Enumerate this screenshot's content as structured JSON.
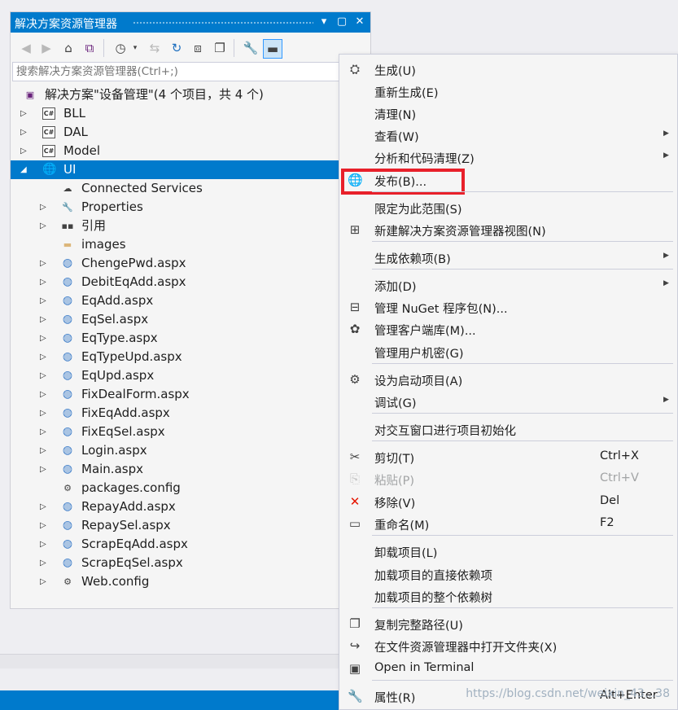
{
  "panel": {
    "title": "解决方案资源管理器",
    "search_placeholder": "搜索解决方案资源管理器(Ctrl+;)",
    "tree": [
      {
        "label": "解决方案\"设备管理\"(4 个项目，共 4 个)",
        "icon": "solution-icon"
      },
      {
        "label": "BLL",
        "icon": "csharp-project-icon"
      },
      {
        "label": "DAL",
        "icon": "csharp-project-icon"
      },
      {
        "label": "Model",
        "icon": "csharp-project-icon"
      },
      {
        "label": "UI",
        "icon": "web-project-icon"
      },
      {
        "label": "Connected Services",
        "icon": "cloud-icon"
      },
      {
        "label": "Properties",
        "icon": "wrench-icon"
      },
      {
        "label": "引用",
        "icon": "references-icon"
      },
      {
        "label": "images",
        "icon": "folder-icon"
      },
      {
        "label": "ChengePwd.aspx",
        "icon": "aspx-icon"
      },
      {
        "label": "DebitEqAdd.aspx",
        "icon": "aspx-icon"
      },
      {
        "label": "EqAdd.aspx",
        "icon": "aspx-icon"
      },
      {
        "label": "EqSel.aspx",
        "icon": "aspx-icon"
      },
      {
        "label": "EqType.aspx",
        "icon": "aspx-icon"
      },
      {
        "label": "EqTypeUpd.aspx",
        "icon": "aspx-icon"
      },
      {
        "label": "EqUpd.aspx",
        "icon": "aspx-icon"
      },
      {
        "label": "FixDealForm.aspx",
        "icon": "aspx-icon"
      },
      {
        "label": "FixEqAdd.aspx",
        "icon": "aspx-icon"
      },
      {
        "label": "FixEqSel.aspx",
        "icon": "aspx-icon"
      },
      {
        "label": "Login.aspx",
        "icon": "aspx-icon"
      },
      {
        "label": "Main.aspx",
        "icon": "aspx-icon"
      },
      {
        "label": "packages.config",
        "icon": "config-icon"
      },
      {
        "label": "RepayAdd.aspx",
        "icon": "aspx-icon"
      },
      {
        "label": "RepaySel.aspx",
        "icon": "aspx-icon"
      },
      {
        "label": "ScrapEqAdd.aspx",
        "icon": "aspx-icon"
      },
      {
        "label": "ScrapEqSel.aspx",
        "icon": "aspx-icon"
      },
      {
        "label": "Web.config",
        "icon": "config-icon"
      }
    ]
  },
  "menu": {
    "items": [
      {
        "label": "生成(U)"
      },
      {
        "label": "重新生成(E)"
      },
      {
        "label": "清理(N)"
      },
      {
        "label": "查看(W)"
      },
      {
        "label": "分析和代码清理(Z)"
      },
      {
        "label": "发布(B)..."
      },
      {
        "label": "限定为此范围(S)"
      },
      {
        "label": "新建解决方案资源管理器视图(N)"
      },
      {
        "label": "生成依赖项(B)"
      },
      {
        "label": "添加(D)"
      },
      {
        "label": "管理 NuGet 程序包(N)..."
      },
      {
        "label": "管理客户端库(M)..."
      },
      {
        "label": "管理用户机密(G)"
      },
      {
        "label": "设为启动项目(A)"
      },
      {
        "label": "调试(G)"
      },
      {
        "label": "对交互窗口进行项目初始化"
      },
      {
        "label": "剪切(T)",
        "shortcut": "Ctrl+X"
      },
      {
        "label": "粘贴(P)",
        "shortcut": "Ctrl+V"
      },
      {
        "label": "移除(V)",
        "shortcut": "Del"
      },
      {
        "label": "重命名(M)",
        "shortcut": "F2"
      },
      {
        "label": "卸载项目(L)"
      },
      {
        "label": "加载项目的直接依赖项"
      },
      {
        "label": "加载项目的整个依赖树"
      },
      {
        "label": "复制完整路径(U)"
      },
      {
        "label": "在文件资源管理器中打开文件夹(X)"
      },
      {
        "label": "Open in Terminal"
      },
      {
        "label": "属性(R)",
        "shortcut": "Alt+Enter"
      }
    ]
  },
  "watermark": "https://blog.csdn.net/weixin_43...38",
  "colors": {
    "accent": "#007acc",
    "highlight_box": "#e8202a"
  }
}
